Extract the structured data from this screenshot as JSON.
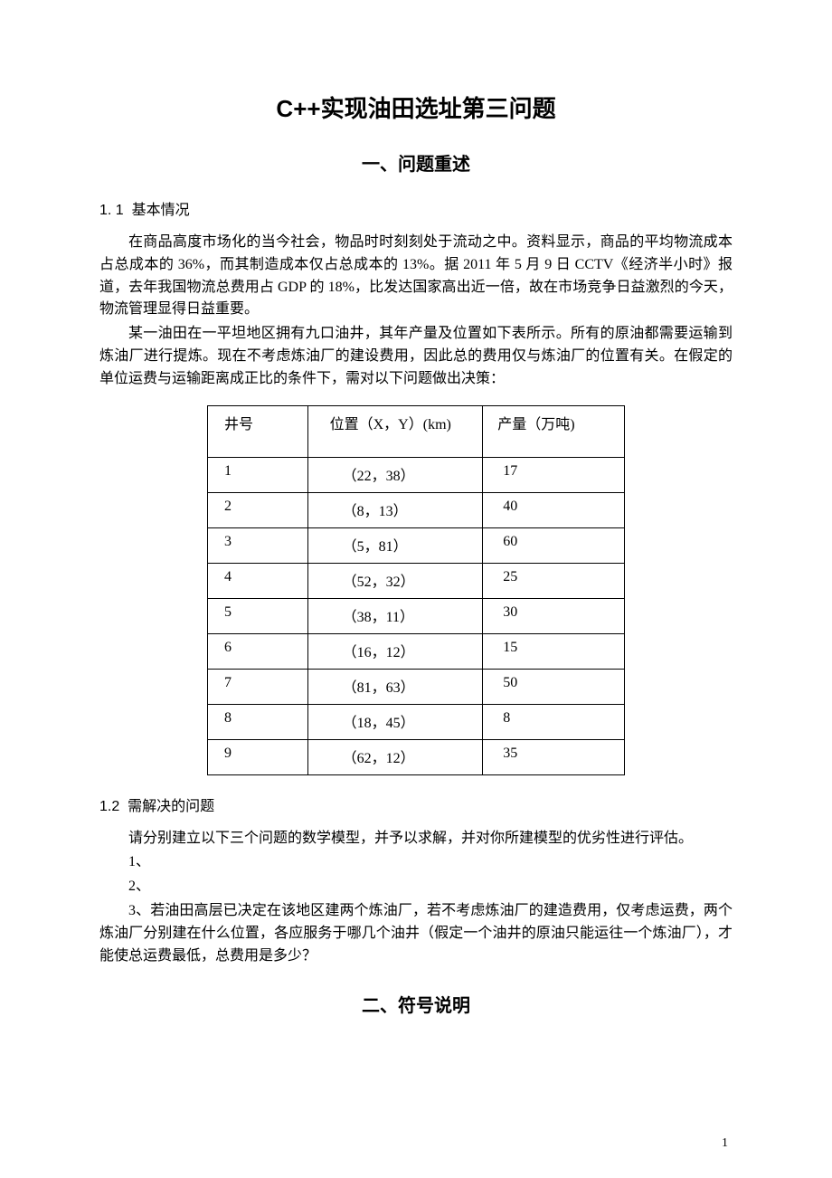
{
  "title": "C++实现油田选址第三问题",
  "section1": {
    "heading": "一、问题重述",
    "sub1": {
      "number": "1. 1",
      "label": "基本情况",
      "paras": [
        "在商品高度市场化的当今社会，物品时时刻刻处于流动之中。资料显示，商品的平均物流成本占总成本的 36%，而其制造成本仅占总成本的 13%。据 2011 年 5 月 9 日 CCTV《经济半小时》报道，去年我国物流总费用占 GDP 的 18%，比发达国家高出近一倍，故在市场竞争日益激烈的今天，物流管理显得日益重要。",
        "某一油田在一平坦地区拥有九口油井，其年产量及位置如下表所示。所有的原油都需要运输到炼油厂进行提炼。现在不考虑炼油厂的建设费用，因此总的费用仅与炼油厂的位置有关。在假定的单位运费与运输距离成正比的条件下，需对以下问题做出决策："
      ]
    },
    "table": {
      "headers": [
        "井号",
        "位置（X，Y）(km)",
        "产量（万吨)"
      ],
      "rows": [
        {
          "id": "1",
          "pos": "（22，38）",
          "out": "17"
        },
        {
          "id": "2",
          "pos": "（8，13）",
          "out": "40"
        },
        {
          "id": "3",
          "pos": "（5，81）",
          "out": "60"
        },
        {
          "id": "4",
          "pos": "（52，32）",
          "out": "25"
        },
        {
          "id": "5",
          "pos": "（38，11）",
          "out": "30"
        },
        {
          "id": "6",
          "pos": "（16，12）",
          "out": "15"
        },
        {
          "id": "7",
          "pos": "（81，63）",
          "out": "50"
        },
        {
          "id": "8",
          "pos": "（18，45）",
          "out": "8"
        },
        {
          "id": "9",
          "pos": "（62，12）",
          "out": "35"
        }
      ]
    },
    "sub2": {
      "number": "1.2",
      "label": "需解决的问题",
      "intro": "请分别建立以下三个问题的数学模型，并予以求解，并对你所建模型的优劣性进行评估。",
      "items": [
        "1、",
        "2、",
        "3、若油田高层已决定在该地区建两个炼油厂，若不考虑炼油厂的建造费用，仅考虑运费，两个炼油厂分别建在什么位置，各应服务于哪几个油井（假定一个油井的原油只能运往一个炼油厂），才能使总运费最低，总费用是多少？"
      ]
    }
  },
  "section2": {
    "heading": "二、符号说明"
  },
  "pageNumber": "1"
}
